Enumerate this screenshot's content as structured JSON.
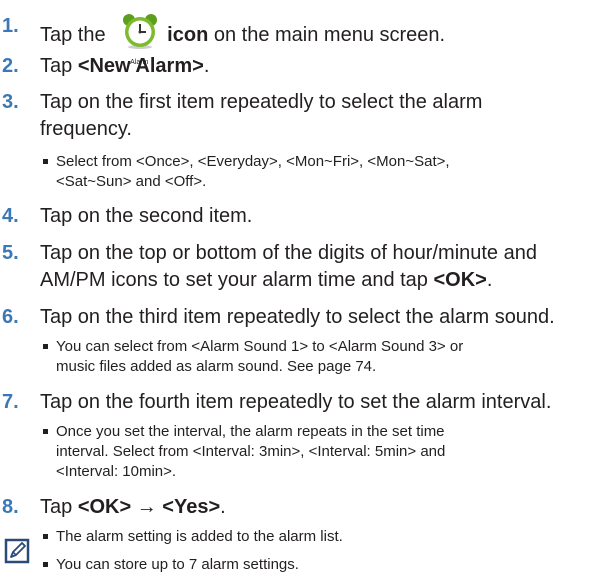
{
  "steps": [
    {
      "num": "1.",
      "pre": "Tap the ",
      "icon_caption": "Alarm",
      "bold": "icon",
      "post": " on the main menu screen."
    },
    {
      "num": "2.",
      "pre": "Tap ",
      "bold": "<New Alarm>",
      "post": "."
    },
    {
      "num": "3.",
      "line1": "Tap on the first item repeatedly to select the alarm",
      "line2": "frequency.",
      "sub_line1": "Select from <Once>, <Everyday>, <Mon~Fri>, <Mon~Sat>,",
      "sub_line2": "<Sat~Sun> and <Off>."
    },
    {
      "num": "4.",
      "text": "Tap on the second item."
    },
    {
      "num": "5.",
      "line1": "Tap on the top or bottom of the digits of hour/minute and",
      "line2_pre": "AM/PM icons to set your alarm time and tap ",
      "line2_bold": "<OK>",
      "line2_post": "."
    },
    {
      "num": "6.",
      "text": "Tap on the third item repeatedly to select the alarm sound.",
      "sub_line1": "You can select from <Alarm Sound 1> to <Alarm Sound 3> or",
      "sub_line2": "music files added as alarm sound. See page 74."
    },
    {
      "num": "7.",
      "text": "Tap on the fourth item repeatedly to set the alarm interval.",
      "sub_line1": "Once you set the interval, the alarm repeats in the set time",
      "sub_line2": "interval. Select from <Interval: 3min>, <Interval: 5min> and",
      "sub_line3": "<Interval: 10min>."
    },
    {
      "num": "8.",
      "pre": "Tap ",
      "bold1": "<OK>",
      "arrow": " → ",
      "bold2": "<Yes>",
      "post": ".",
      "sub_line1": "The alarm setting is added to the alarm list."
    }
  ],
  "note": {
    "text": "You can store up to 7 alarm settings.",
    "icon": "note-pencil-icon"
  },
  "colors": {
    "step_number": "#3b78b6",
    "text": "#231f20",
    "clock_green": "#7dbb2e"
  }
}
